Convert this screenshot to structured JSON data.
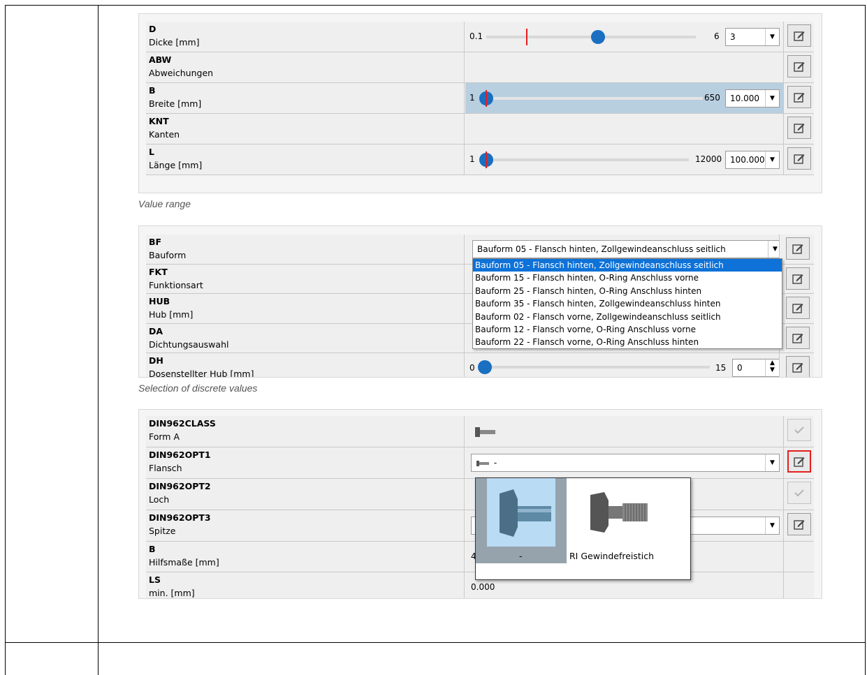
{
  "section1": {
    "caption": "Value range",
    "rows": [
      {
        "code": "D",
        "label": "Dicke [mm]",
        "min": "0.1",
        "max": "6",
        "value": "3",
        "knob_fraction": 0.5,
        "marker_fraction": 0.17
      },
      {
        "code": "ABW",
        "label": "Abweichungen"
      },
      {
        "code": "B",
        "label": "Breite [mm]",
        "min": "1",
        "max": "650",
        "value": "10.000",
        "knob_fraction": 0.0,
        "marker_fraction": 0.0
      },
      {
        "code": "KNT",
        "label": "Kanten"
      },
      {
        "code": "L",
        "label": "Länge [mm]",
        "min": "1",
        "max": "12000",
        "value": "100.000",
        "knob_fraction": 0.0,
        "marker_fraction": 0.0
      }
    ]
  },
  "section2": {
    "caption": "Selection of discrete values",
    "rows": [
      {
        "code": "BF",
        "label": "Bauform"
      },
      {
        "code": "FKT",
        "label": "Funktionsart"
      },
      {
        "code": "HUB",
        "label": "Hub [mm]"
      },
      {
        "code": "DA",
        "label": "Dichtungsauswahl"
      },
      {
        "code": "DH",
        "label": "Dosenstellter Hub [mm]",
        "min": "0",
        "max": "15",
        "value": "0"
      }
    ],
    "combo_value": "Bauform 05 - Flansch hinten, Zollgewindeanschluss seitlich",
    "options": [
      "Bauform 05 - Flansch hinten, Zollgewindeanschluss seitlich",
      "Bauform 15 - Flansch hinten, O-Ring Anschluss vorne",
      "Bauform 25 - Flansch hinten, O-Ring Anschluss hinten",
      "Bauform 35 - Flansch hinten, Zollgewindeanschluss hinten",
      "Bauform 02 - Flansch vorne, Zollgewindeanschluss seitlich",
      "Bauform 12 - Flansch vorne, O-Ring Anschluss vorne",
      "Bauform 22 - Flansch vorne, O-Ring Anschluss hinten"
    ]
  },
  "section3": {
    "rows": [
      {
        "code": "DIN962CLASS",
        "label": "Form A"
      },
      {
        "code": "DIN962OPT1",
        "label": "Flansch",
        "combo_value": "-"
      },
      {
        "code": "DIN962OPT2",
        "label": "Loch"
      },
      {
        "code": "DIN962OPT3",
        "label": "Spitze"
      },
      {
        "code": "B",
        "label": "Hilfsmaße [mm]",
        "value": "4"
      },
      {
        "code": "LS",
        "label": "min. [mm]",
        "value": "0.000"
      }
    ],
    "popup_options": [
      "-",
      "RI Gewindefreistich"
    ]
  },
  "colors": {
    "accent": "#1a6fc0",
    "selection": "#0e72d8",
    "highlight": "#e41e1e"
  }
}
